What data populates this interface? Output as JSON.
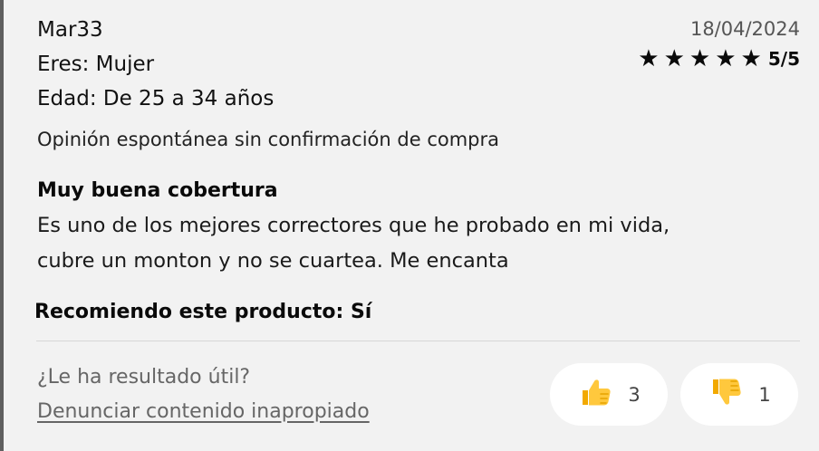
{
  "review": {
    "username": "Mar33",
    "date": "18/04/2024",
    "gender": "Eres: Mujer",
    "age": "Edad: De 25 a 34 años",
    "rating": {
      "value": 5,
      "max": 5,
      "label": "5/5"
    },
    "verification_notice": "Opinión espontánea sin confirmación de compra",
    "title": "Muy buena cobertura",
    "body_line_1": "Es uno de los mejores correctores que he probado en mi vida,",
    "body_line_2": "cubre un monton y no se cuartea. Me encanta",
    "recommendation": "Recomiendo este producto: Sí"
  },
  "feedback": {
    "question": "¿Le ha resultado útil?",
    "report_link": "Denunciar contenido inapropiado",
    "helpful_icon": "thumbs-up-icon",
    "helpful_count": "3",
    "unhelpful_icon": "thumbs-down-icon",
    "unhelpful_count": "1"
  },
  "colors": {
    "card_background": "#f2f2f2",
    "star_color": "#0a0a0a",
    "muted_text": "#666666"
  }
}
